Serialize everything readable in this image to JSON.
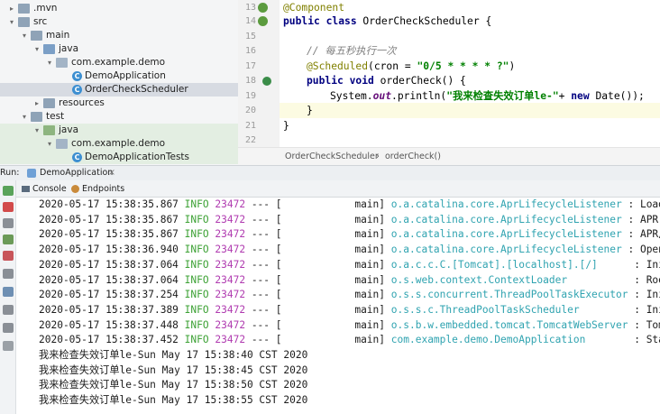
{
  "tree": {
    "items": [
      {
        "label": ".mvn",
        "indent": 0,
        "arrow": "▸",
        "icon": "folder"
      },
      {
        "label": "src",
        "indent": 0,
        "arrow": "▾",
        "icon": "folder"
      },
      {
        "label": "main",
        "indent": 1,
        "arrow": "▾",
        "icon": "folder"
      },
      {
        "label": "java",
        "indent": 2,
        "arrow": "▾",
        "icon": "folder-src"
      },
      {
        "label": "com.example.demo",
        "indent": 3,
        "arrow": "▾",
        "icon": "package"
      },
      {
        "label": "DemoApplication",
        "indent": 4,
        "arrow": "",
        "icon": "class"
      },
      {
        "label": "OrderCheckScheduler",
        "indent": 4,
        "arrow": "",
        "icon": "class"
      },
      {
        "label": "resources",
        "indent": 2,
        "arrow": "▸",
        "icon": "folder"
      },
      {
        "label": "test",
        "indent": 1,
        "arrow": "▾",
        "icon": "folder"
      },
      {
        "label": "java",
        "indent": 2,
        "arrow": "▾",
        "icon": "folder-test"
      },
      {
        "label": "com.example.demo",
        "indent": 3,
        "arrow": "▾",
        "icon": "package"
      },
      {
        "label": "DemoApplicationTests",
        "indent": 4,
        "arrow": "",
        "icon": "class"
      }
    ]
  },
  "editor": {
    "line_numbers": [
      "13",
      "14",
      "15",
      "16",
      "17",
      "18",
      "19",
      "20",
      "21",
      "22"
    ],
    "code": {
      "l13": "@Component",
      "l14_kw": "public class ",
      "l14_rest": "OrderCheckScheduler {",
      "l16_comment": "// 每五秒执行一次",
      "l17_ann": "@Scheduled",
      "l17_a": "(cron = ",
      "l17_str": "\"0/5 * * * * ?\"",
      "l17_b": ")",
      "l18_kw": "public void ",
      "l18_rest": "orderCheck() {",
      "l19_a": "System.",
      "l19_out": "out",
      "l19_b": ".println(",
      "l19_str": "\"我来检查失效订单le-\"",
      "l19_c": "+ ",
      "l19_kw": "new ",
      "l19_d": "Date());",
      "l20": "}",
      "l21": "}"
    },
    "breadcrumb": {
      "class": "OrderCheckScheduler",
      "sep": "›",
      "method": "orderCheck()"
    }
  },
  "run": {
    "label": "Run:",
    "config": "DemoApplication",
    "tabs": {
      "console": "Console",
      "endpoints": "Endpoints"
    }
  },
  "console": {
    "logs": [
      {
        "time": "2020-05-17 15:38:35.867",
        "level": "INFO",
        "pid": "23472",
        "sep": "--- [",
        "thread": "           main]",
        "logger": "o.a.catalina.core.AprLifecycleListener",
        "msg": ": Loaded"
      },
      {
        "time": "2020-05-17 15:38:35.867",
        "level": "INFO",
        "pid": "23472",
        "sep": "--- [",
        "thread": "           main]",
        "logger": "o.a.catalina.core.AprLifecycleListener",
        "msg": ": APR cap"
      },
      {
        "time": "2020-05-17 15:38:35.867",
        "level": "INFO",
        "pid": "23472",
        "sep": "--- [",
        "thread": "           main]",
        "logger": "o.a.catalina.core.AprLifecycleListener",
        "msg": ": APR/Ope"
      },
      {
        "time": "2020-05-17 15:38:36.940",
        "level": "INFO",
        "pid": "23472",
        "sep": "--- [",
        "thread": "           main]",
        "logger": "o.a.catalina.core.AprLifecycleListener",
        "msg": ": OpenSSL"
      },
      {
        "time": "2020-05-17 15:38:37.064",
        "level": "INFO",
        "pid": "23472",
        "sep": "--- [",
        "thread": "           main]",
        "logger": "o.a.c.c.C.[Tomcat].[localhost].[/]     ",
        "msg": ": Initial"
      },
      {
        "time": "2020-05-17 15:38:37.064",
        "level": "INFO",
        "pid": "23472",
        "sep": "--- [",
        "thread": "           main]",
        "logger": "o.s.web.context.ContextLoader          ",
        "msg": ": Root We"
      },
      {
        "time": "2020-05-17 15:38:37.254",
        "level": "INFO",
        "pid": "23472",
        "sep": "--- [",
        "thread": "           main]",
        "logger": "o.s.s.concurrent.ThreadPoolTaskExecutor",
        "msg": ": Initial"
      },
      {
        "time": "2020-05-17 15:38:37.389",
        "level": "INFO",
        "pid": "23472",
        "sep": "--- [",
        "thread": "           main]",
        "logger": "o.s.s.c.ThreadPoolTaskScheduler        ",
        "msg": ": Initial"
      },
      {
        "time": "2020-05-17 15:38:37.448",
        "level": "INFO",
        "pid": "23472",
        "sep": "--- [",
        "thread": "           main]",
        "logger": "o.s.b.w.embedded.tomcat.TomcatWebServer",
        "msg": ": Tomcat "
      },
      {
        "time": "2020-05-17 15:38:37.452",
        "level": "INFO",
        "pid": "23472",
        "sep": "--- [",
        "thread": "           main]",
        "logger": "com.example.demo.DemoApplication       ",
        "msg": ": Started"
      }
    ],
    "output": [
      "我来检查失效订单le-Sun May 17 15:38:40 CST 2020",
      "我来检查失效订单le-Sun May 17 15:38:45 CST 2020",
      "我来检查失效订单le-Sun May 17 15:38:50 CST 2020",
      "我来检查失效订单le-Sun May 17 15:38:55 CST 2020"
    ]
  },
  "colors": {
    "info": "#3ea236",
    "pid": "#b03bb0",
    "logger": "#2fa3b0",
    "keyword": "#000080",
    "string": "#008000",
    "annotation": "#808000"
  }
}
